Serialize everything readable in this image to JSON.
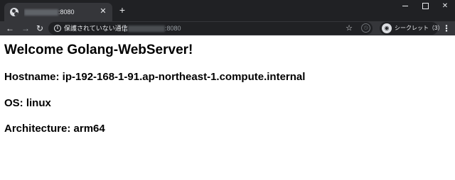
{
  "browser": {
    "tab": {
      "title_suffix": ":8080",
      "close_icon": "close-icon"
    },
    "new_tab_label": "+",
    "toolbar": {
      "security_text": "保護されていない通信",
      "url_suffix": ":8080",
      "incognito_label": "シークレット（3）"
    },
    "colors": {
      "tabstrip": "#202124",
      "toolbar": "#35363a",
      "page_background": "#ffffff",
      "text": "#000000"
    }
  },
  "page": {
    "heading": "Welcome Golang-WebServer!",
    "hostname_line": "Hostname: ip-192-168-1-91.ap-northeast-1.compute.internal",
    "os_line": "OS: linux",
    "architecture_line": "Architecture: arm64"
  }
}
